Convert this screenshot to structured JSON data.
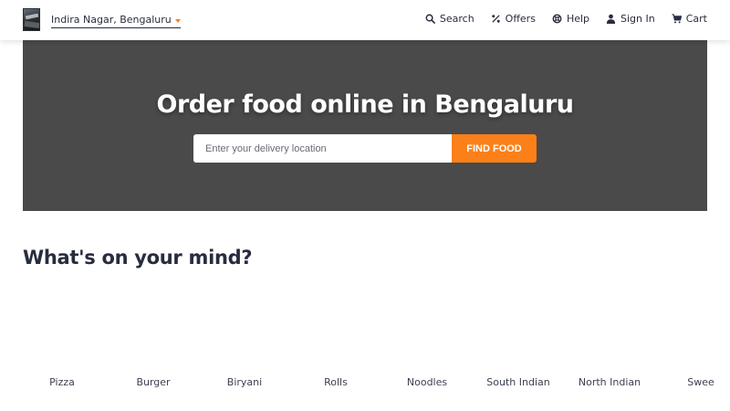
{
  "header": {
    "location": "Indira Nagar, Bengaluru",
    "nav": [
      {
        "label": "Search",
        "icon": "search-icon"
      },
      {
        "label": "Offers",
        "icon": "percent-icon"
      },
      {
        "label": "Help",
        "icon": "help-lifebuoy-icon"
      },
      {
        "label": "Sign In",
        "icon": "user-icon"
      },
      {
        "label": "Cart",
        "icon": "cart-icon"
      }
    ]
  },
  "hero": {
    "title": "Order food online in Bengaluru",
    "search_placeholder": "Enter your delivery location",
    "find_button": "FIND FOOD"
  },
  "mind": {
    "title": "What's on your mind?",
    "categories": [
      "Pizza",
      "Burger",
      "Biryani",
      "Rolls",
      "Noodles",
      "South Indian",
      "North Indian",
      "Swee"
    ]
  },
  "colors": {
    "accent": "#fc8019",
    "hero_bg": "#4a4a4a",
    "text": "#282c3f"
  }
}
